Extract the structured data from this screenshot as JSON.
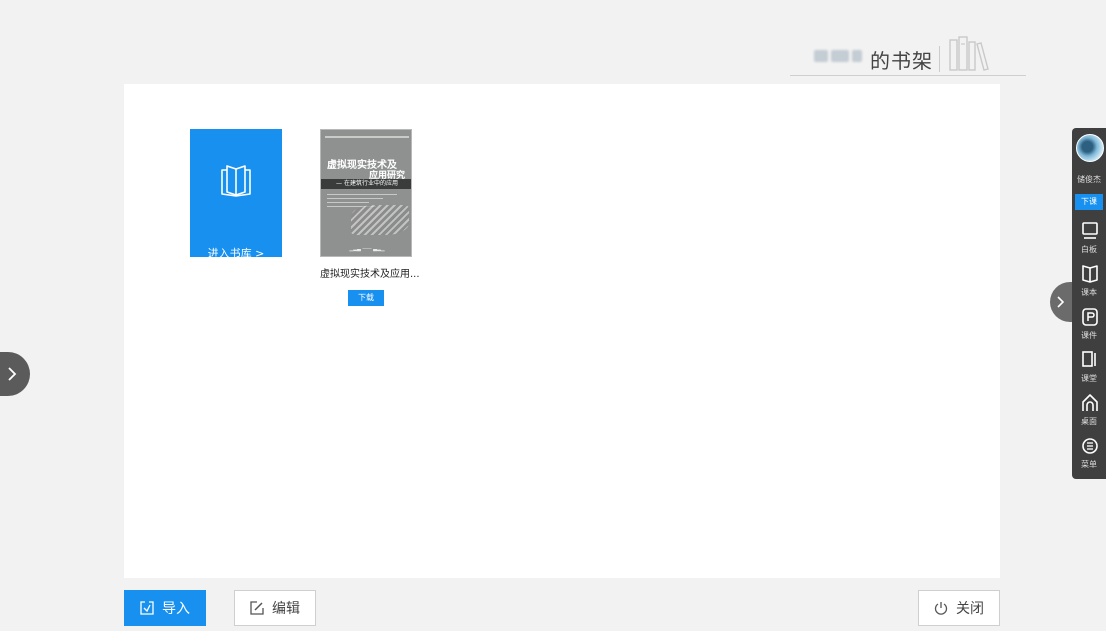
{
  "header": {
    "title": "的书架"
  },
  "library_tile": {
    "label": "进入书库 >"
  },
  "books": [
    {
      "title": "虚拟现实技术及应用...",
      "download_label": "下载",
      "cover": {
        "title_line1": "虚拟现实技术及",
        "title_line2": "应用研究",
        "subtitle": "— 在建筑行业中的应用"
      }
    }
  ],
  "buttons": {
    "import": "导入",
    "edit": "编辑",
    "close": "关闭"
  },
  "toolbar": {
    "user_name": "储俊杰",
    "end_class": "下课",
    "tools": [
      {
        "label": "白板",
        "icon": "whiteboard-icon"
      },
      {
        "label": "课本",
        "icon": "textbook-icon"
      },
      {
        "label": "课件",
        "icon": "courseware-icon"
      },
      {
        "label": "课堂",
        "icon": "classroom-icon"
      },
      {
        "label": "桌面",
        "icon": "desktop-home-icon"
      },
      {
        "label": "菜单",
        "icon": "menu-icon"
      }
    ]
  },
  "colors": {
    "accent": "#1890f0",
    "toolbar_bg": "#3f3f3f",
    "page_bg": "#f2f2f2"
  }
}
